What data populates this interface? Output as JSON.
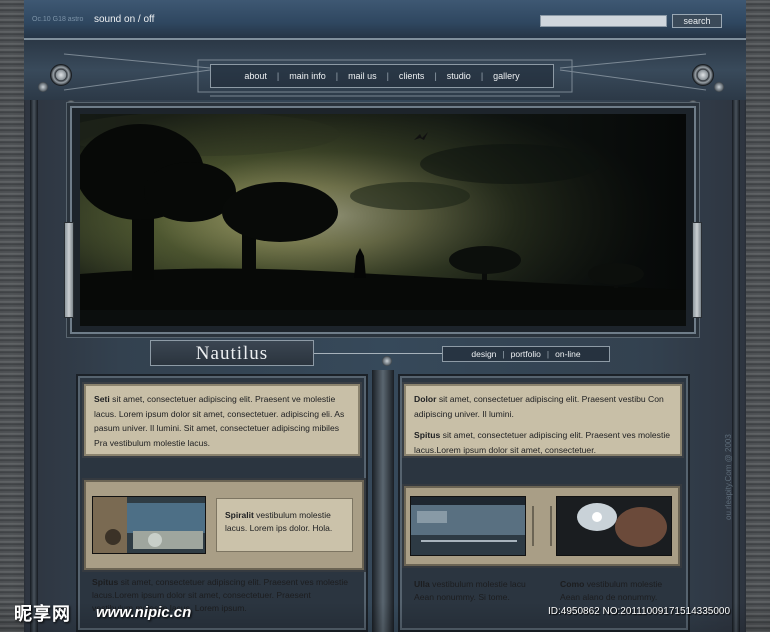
{
  "topbar": {
    "date": "Oc.10 G18 astro",
    "sound_label": "sound on / off",
    "search_value": "",
    "search_button": "search"
  },
  "nav": {
    "items": [
      "about",
      "main info",
      "mail us",
      "clients",
      "studio",
      "gallery"
    ],
    "separator": "|"
  },
  "site": {
    "title": "Nautilus"
  },
  "subnav": {
    "items": [
      "design",
      "portfolio",
      "on-line"
    ],
    "separator": "|"
  },
  "left_note": {
    "lead": "Seti",
    "text": " sit amet, consectetuer adipiscing elit. Praesent ve molestie lacus. Lorem ipsum dolor sit amet, consectetuer.  adipiscing eli. As pasum univer. Il lumini. Sit amet, consectetuer adipiscing mibiles  Pra vestibulum molestie lacus."
  },
  "right_note": {
    "p1_lead": "Dolor",
    "p1_text": " sit amet, consectetuer adipiscing elit. Praesent vestibu Con adipiscing univer. Il lumini.",
    "p2_lead": "Spitus",
    "p2_text": " sit amet, consectetuer adipiscing elit. Praesent ves molestie lacus.Lorem ipsum dolor sit amet, consectetuer."
  },
  "left_feature": {
    "caption_lead": "Spiralit",
    "caption_text": " vestibulum molestie lacus. Lorem ips dolor.  Hola.",
    "bottom_lead": "Spitus",
    "bottom_text": " sit amet, consectetuer adipiscing elit. Praesent ves molestie lacus.Lorem ipsum dolor sit amet, consectetuer. Praesent vestibulum molestie lacus. Lorem ipsum."
  },
  "right_feature": {
    "left_lead": "Ulla",
    "left_text": " vestibulum molestie lacu Aean nonummy. Si tome.",
    "right_lead": "Como",
    "right_text": " vestibulum molestie Aean alano de nonummy."
  },
  "copyright": "ou.rleapity.Com @ 2003",
  "watermark": {
    "logo": "昵享网",
    "url": "www.nipic.cn",
    "id": "ID:4950862 NO:20111009171514335000"
  },
  "colors": {
    "sky_glow": "#c9c98a",
    "panel_paper": "#c8bfa7",
    "steel": "#36495a"
  }
}
